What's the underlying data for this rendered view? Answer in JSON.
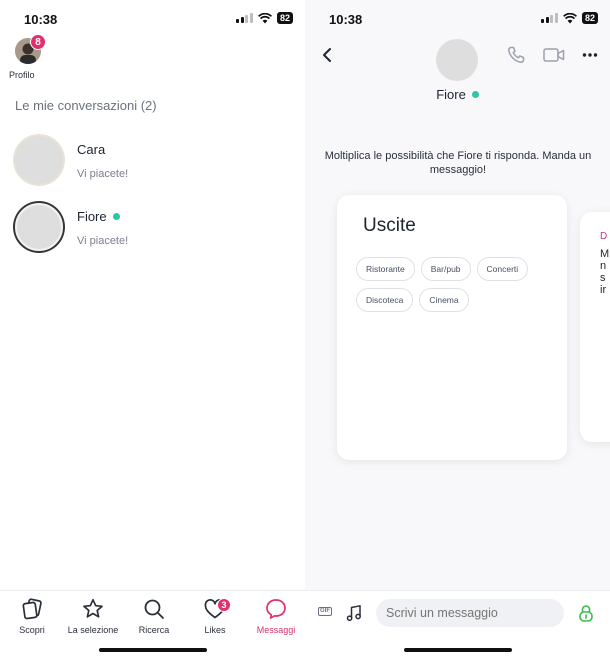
{
  "status_bar": {
    "time": "10:38",
    "battery": "82"
  },
  "left_screen": {
    "profile": {
      "label": "Profilo",
      "badge": "8"
    },
    "conversations_title": "Le mie conversazioni (2)",
    "conversations": [
      {
        "name": "Cara",
        "subtitle": "Vi piacete!",
        "online": false
      },
      {
        "name": "Fiore",
        "subtitle": "Vi piacete!",
        "online": true
      }
    ],
    "tabs": [
      {
        "label": "Scopri",
        "icon": "cards-icon",
        "active": false
      },
      {
        "label": "La selezione",
        "icon": "star-icon",
        "active": false
      },
      {
        "label": "Ricerca",
        "icon": "search-icon",
        "active": false
      },
      {
        "label": "Likes",
        "icon": "heart-icon",
        "active": false,
        "badge": "3"
      },
      {
        "label": "Messaggi",
        "icon": "chat-bubble-icon",
        "active": true
      }
    ]
  },
  "right_screen": {
    "contact_name": "Fiore",
    "prompt": "Moltiplica le possibilità che Fiore ti risponda. Manda un messaggio!",
    "card": {
      "title": "Uscite",
      "chips": [
        "Ristorante",
        "Bar/pub",
        "Concerti",
        "Discoteca",
        "Cinema"
      ]
    },
    "next_card_peek": {
      "heading": "D",
      "lines": [
        "M",
        "n",
        "s",
        "ir"
      ]
    },
    "composer": {
      "gif_label": "GIF",
      "placeholder": "Scrivi un messaggio"
    }
  },
  "colors": {
    "accent": "#e0306f",
    "online": "#2ec4a5",
    "lock": "#3dbb4a"
  }
}
